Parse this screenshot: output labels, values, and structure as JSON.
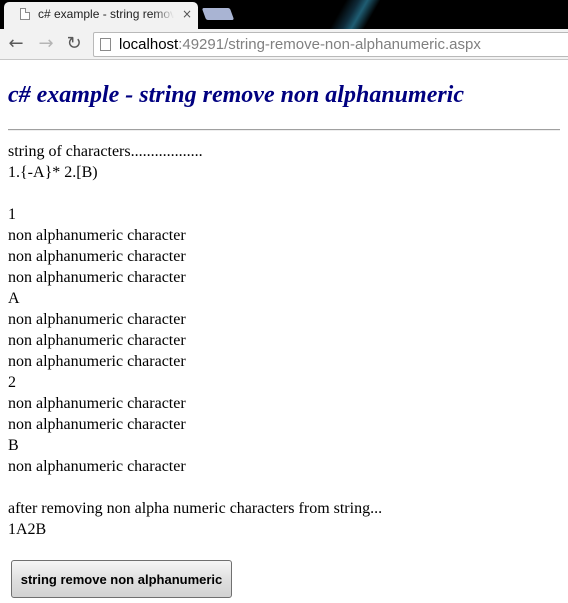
{
  "browser": {
    "tab_title": "c# example - string remove non alphanumeric",
    "tab_close": "×",
    "url_host": "localhost",
    "url_rest": ":49291/string-remove-non-alphanumeric.aspx",
    "back": "←",
    "forward": "→",
    "reload": "↻"
  },
  "page": {
    "title": "c# example - string remove non alphanumeric",
    "output_lines": [
      "string of characters..................",
      "1.{-A}* 2.[B)",
      "",
      "1",
      "non alphanumeric character",
      "non alphanumeric character",
      "non alphanumeric character",
      "A",
      "non alphanumeric character",
      "non alphanumeric character",
      "non alphanumeric character",
      "2",
      "non alphanumeric character",
      "non alphanumeric character",
      "B",
      "non alphanumeric character",
      "",
      "after removing non alpha numeric characters from string...",
      "1A2B"
    ],
    "button_label": "string remove non alphanumeric"
  },
  "colors": {
    "title": "#000080",
    "text": "#000000",
    "tabstrip": "#000000",
    "toolbar": "#f2f2f2"
  }
}
